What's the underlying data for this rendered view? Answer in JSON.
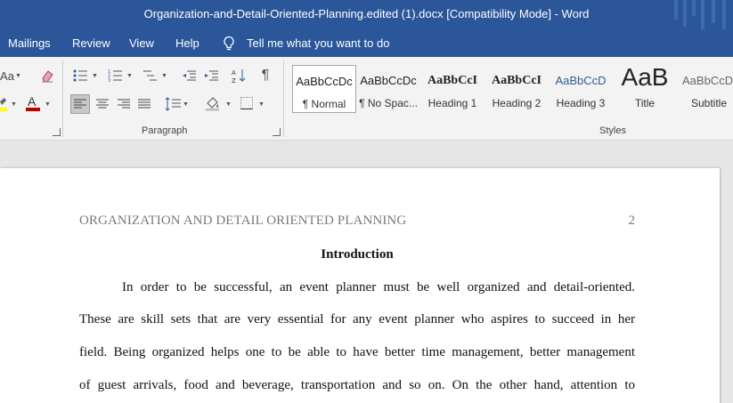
{
  "window": {
    "title": "Organization-and-Detail-Oriented-Planning.edited (1).docx [Compatibility Mode]  -  Word"
  },
  "tabs": [
    {
      "label": "Mailings"
    },
    {
      "label": "Review"
    },
    {
      "label": "View"
    },
    {
      "label": "Help"
    }
  ],
  "tell_me": {
    "placeholder": "Tell me what you want to do",
    "icon": "lightbulb-icon"
  },
  "ribbon": {
    "font_group": {
      "change_case_label": "Aa",
      "font_color": "#c00000",
      "highlight_color": "#ffff00"
    },
    "paragraph_group": {
      "label": "Paragraph"
    },
    "styles_group": {
      "label": "Styles",
      "items": [
        {
          "preview": "AaBbCcDc",
          "name": "¶ Normal"
        },
        {
          "preview": "AaBbCcDc",
          "name": "¶ No Spac..."
        },
        {
          "preview": "AaBbCcI",
          "name": "Heading 1"
        },
        {
          "preview": "AaBbCcI",
          "name": "Heading 2"
        },
        {
          "preview": "AaBbCcD",
          "name": "Heading 3"
        },
        {
          "preview": "AaB",
          "name": "Title"
        },
        {
          "preview": "AaBbCcD",
          "name": "Subtitle"
        }
      ]
    }
  },
  "document": {
    "running_head": "ORGANIZATION AND DETAIL ORIENTED PLANNING",
    "page_number": "2",
    "heading": "Introduction",
    "lines": [
      "In order to be successful, an event planner must be well organized and detail-oriented.",
      "These are skill sets that are very essential for any event planner who aspires to succeed in her",
      "field. Being organized helps one to be able to have better time management, better management",
      "of guest arrivals, food and beverage, transportation and so on.  On the other hand, attention to"
    ]
  },
  "colors": {
    "titlebar": "#2b579a",
    "ribbon": "#f3f3f3",
    "canvas": "#e6e6e6"
  }
}
